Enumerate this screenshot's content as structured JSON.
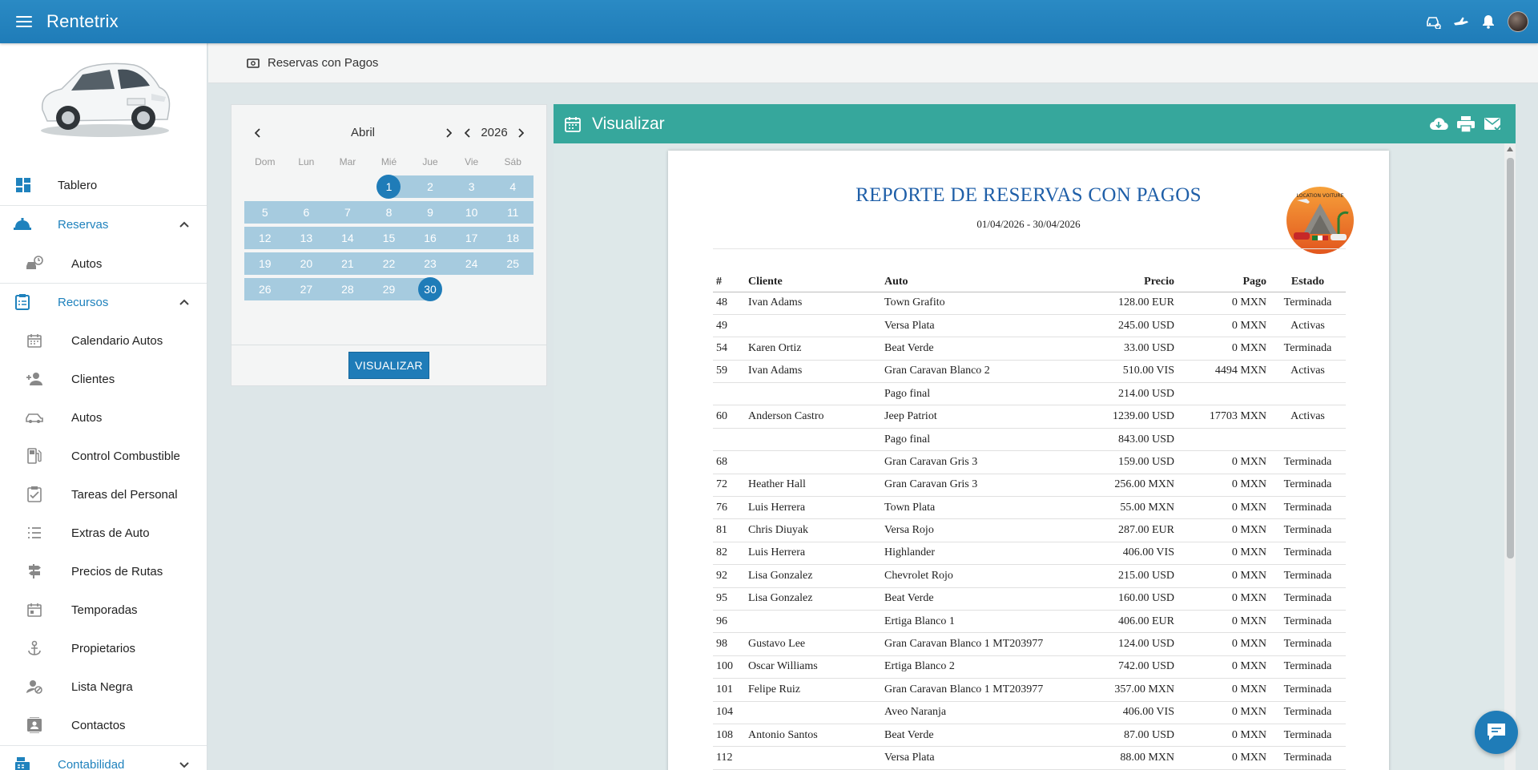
{
  "app": {
    "title": "Rentetrix",
    "icons": [
      "car-search-icon",
      "plane-icon",
      "bell-icon",
      "user-avatar"
    ]
  },
  "sidebar": {
    "items": [
      {
        "label": "Tablero",
        "icon": "dashboard-icon"
      },
      {
        "label": "Reservas",
        "icon": "bell-service-icon",
        "section": true,
        "expanded": true
      },
      {
        "label": "Autos",
        "icon": "car-clock-icon"
      },
      {
        "label": "Recursos",
        "icon": "clipboard-icon",
        "section": true,
        "expanded": true
      },
      {
        "label": "Calendario Autos",
        "icon": "calendar-icon"
      },
      {
        "label": "Clientes",
        "icon": "person-add-icon"
      },
      {
        "label": "Autos",
        "icon": "car-icon"
      },
      {
        "label": "Control Combustible",
        "icon": "fuel-icon"
      },
      {
        "label": "Tareas del Personal",
        "icon": "clipboard-check-icon"
      },
      {
        "label": "Extras de Auto",
        "icon": "list-icon"
      },
      {
        "label": "Precios de Rutas",
        "icon": "signpost-icon"
      },
      {
        "label": "Temporadas",
        "icon": "calendar-range-icon"
      },
      {
        "label": "Propietarios",
        "icon": "anchor-icon"
      },
      {
        "label": "Lista Negra",
        "icon": "person-block-icon"
      },
      {
        "label": "Contactos",
        "icon": "contacts-icon"
      },
      {
        "label": "Contabilidad",
        "icon": "cash-register-icon",
        "section": true,
        "expanded": false
      }
    ]
  },
  "header": {
    "title": "Reservas con Pagos"
  },
  "calendar": {
    "month": "Abril",
    "year": "2026",
    "weekdays": [
      "Dom",
      "Lun",
      "Mar",
      "Mié",
      "Jue",
      "Vie",
      "Sáb"
    ],
    "first_weekday_index": 3,
    "days_in_month": 30,
    "range_start": 1,
    "range_end": 30,
    "button_label": "VISUALIZAR"
  },
  "viewer": {
    "title": "Visualizar",
    "actions": [
      "cloud-download-icon",
      "print-icon",
      "email-icon"
    ]
  },
  "report": {
    "title": "REPORTE DE RESERVAS CON PAGOS",
    "date_range": "01/04/2026 - 30/04/2026",
    "logo_text": "LOCATION VOITURE",
    "columns": [
      "#",
      "Cliente",
      "Auto",
      "Precio",
      "Pago",
      "Estado"
    ],
    "rows": [
      [
        "48",
        "Ivan Adams",
        "Town Grafito",
        "128.00 EUR",
        "0 MXN",
        "Terminada"
      ],
      [
        "49",
        "",
        "Versa Plata",
        "245.00 USD",
        "0 MXN",
        "Activas"
      ],
      [
        "54",
        "Karen Ortiz",
        "Beat Verde",
        "33.00 USD",
        "0 MXN",
        "Terminada"
      ],
      [
        "59",
        "Ivan Adams",
        "Gran Caravan Blanco 2",
        "510.00 VIS",
        "4494 MXN",
        "Activas"
      ],
      [
        "",
        "",
        "Pago final",
        "214.00 USD",
        "",
        ""
      ],
      [
        "60",
        "Anderson Castro",
        "Jeep Patriot",
        "1239.00 USD",
        "17703 MXN",
        "Activas"
      ],
      [
        "",
        "",
        "Pago final",
        "843.00 USD",
        "",
        ""
      ],
      [
        "68",
        "",
        "Gran Caravan Gris 3",
        "159.00 USD",
        "0 MXN",
        "Terminada"
      ],
      [
        "72",
        "Heather Hall",
        "Gran Caravan Gris 3",
        "256.00 MXN",
        "0 MXN",
        "Terminada"
      ],
      [
        "76",
        "Luis Herrera",
        "Town Plata",
        "55.00 MXN",
        "0 MXN",
        "Terminada"
      ],
      [
        "81",
        "Chris Diuyak",
        "Versa Rojo",
        "287.00 EUR",
        "0 MXN",
        "Terminada"
      ],
      [
        "82",
        "Luis Herrera",
        "Highlander",
        "406.00 VIS",
        "0 MXN",
        "Terminada"
      ],
      [
        "92",
        "Lisa Gonzalez",
        "Chevrolet Rojo",
        "215.00 USD",
        "0 MXN",
        "Terminada"
      ],
      [
        "95",
        "Lisa Gonzalez",
        "Beat Verde",
        "160.00 USD",
        "0 MXN",
        "Terminada"
      ],
      [
        "96",
        "",
        "Ertiga Blanco 1",
        "406.00 EUR",
        "0 MXN",
        "Terminada"
      ],
      [
        "98",
        "Gustavo Lee",
        "Gran Caravan Blanco 1 MT203977",
        "124.00 USD",
        "0 MXN",
        "Terminada"
      ],
      [
        "100",
        "Oscar Williams",
        "Ertiga Blanco 2",
        "742.00 USD",
        "0 MXN",
        "Terminada"
      ],
      [
        "101",
        "Felipe Ruiz",
        "Gran Caravan Blanco 1 MT203977",
        "357.00 MXN",
        "0 MXN",
        "Terminada"
      ],
      [
        "104",
        "",
        "Aveo Naranja",
        "406.00 VIS",
        "0 MXN",
        "Terminada"
      ],
      [
        "108",
        "Antonio Santos",
        "Beat Verde",
        "87.00 USD",
        "0 MXN",
        "Terminada"
      ],
      [
        "112",
        "",
        "Versa Plata",
        "88.00 MXN",
        "0 MXN",
        "Terminada"
      ]
    ]
  },
  "colors": {
    "topbar": "#1f7cb8",
    "accent": "#1f82bd",
    "viewer_bar": "#36a79c",
    "calendar_range": "#a6cbdf",
    "report_title": "#1f5fa8"
  }
}
